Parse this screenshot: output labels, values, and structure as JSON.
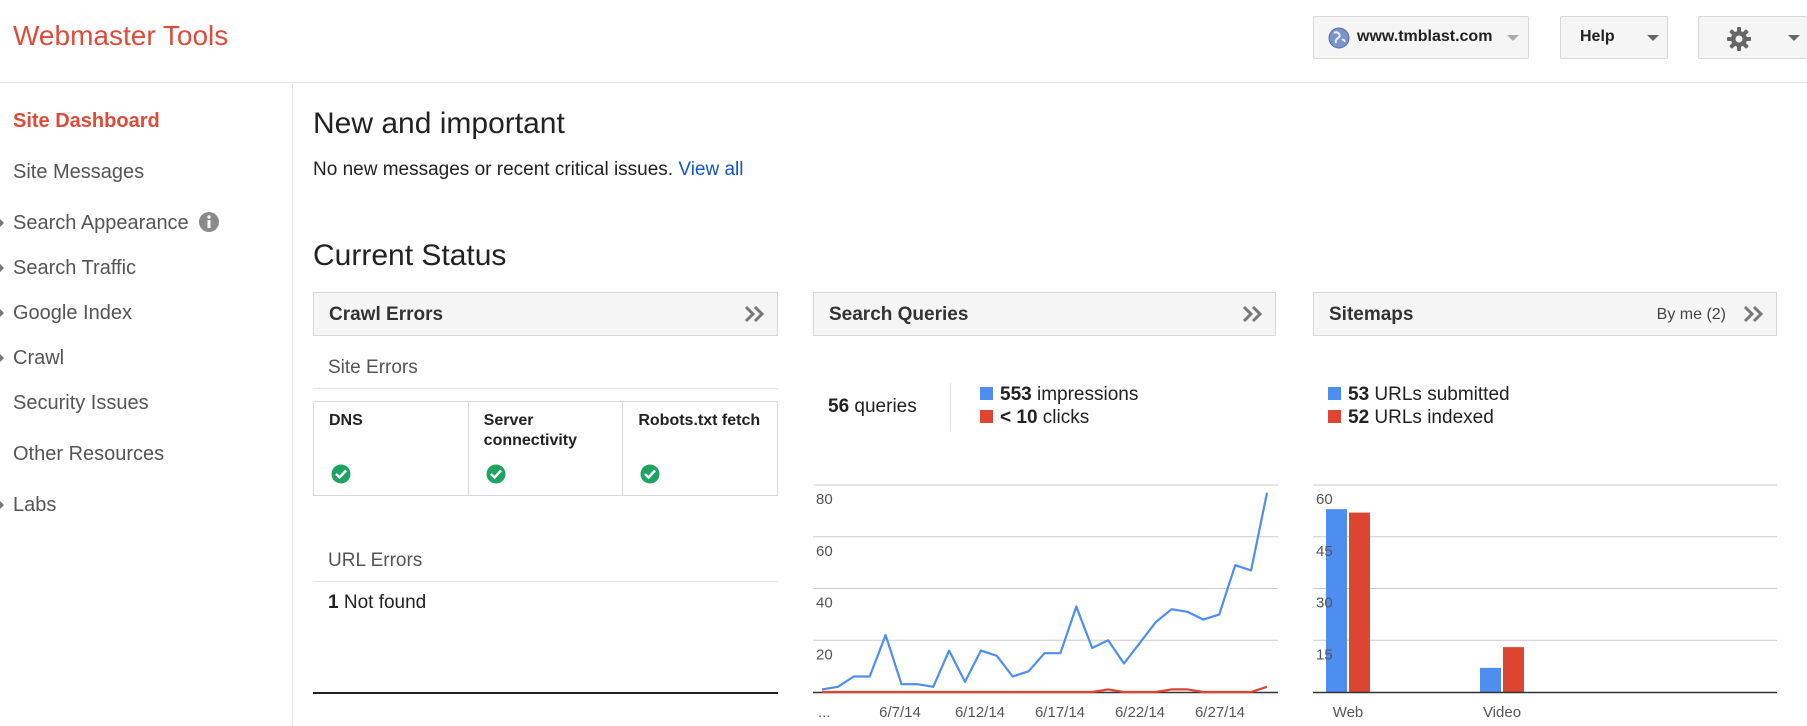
{
  "header": {
    "app_title": "Webmaster Tools",
    "site_selector": "www.tmblast.com",
    "help_label": "Help"
  },
  "sidebar": {
    "items": [
      {
        "label": "Site Dashboard",
        "active": true,
        "expandable": false
      },
      {
        "label": "Site Messages",
        "active": false,
        "expandable": false
      },
      {
        "label": "Search Appearance",
        "active": false,
        "expandable": true
      },
      {
        "label": "Search Traffic",
        "active": false,
        "expandable": true
      },
      {
        "label": "Google Index",
        "active": false,
        "expandable": true
      },
      {
        "label": "Crawl",
        "active": false,
        "expandable": true
      },
      {
        "label": "Security Issues",
        "active": false,
        "expandable": false
      },
      {
        "label": "Other Resources",
        "active": false,
        "expandable": false
      },
      {
        "label": "Labs",
        "active": false,
        "expandable": true
      }
    ]
  },
  "new_important": {
    "heading": "New and important",
    "message": "No new messages or recent critical issues.",
    "link": "View all"
  },
  "current_status": {
    "heading": "Current Status"
  },
  "crawl_errors": {
    "title": "Crawl Errors",
    "site_errors_heading": "Site Errors",
    "site_errors": [
      {
        "label": "DNS",
        "status": "ok"
      },
      {
        "label": "Server connectivity",
        "status": "ok"
      },
      {
        "label": "Robots.txt fetch",
        "status": "ok"
      }
    ],
    "url_errors_heading": "URL Errors",
    "url_errors_count": "1",
    "url_errors_label": "Not found"
  },
  "search_queries": {
    "title": "Search Queries",
    "queries_count": "56",
    "queries_label": "queries",
    "impressions_count": "553",
    "impressions_label": "impressions",
    "clicks_count": "< 10",
    "clicks_label": "clicks"
  },
  "sitemaps": {
    "title": "Sitemaps",
    "filter": "By me (2)",
    "submitted_count": "53",
    "submitted_label": "URLs submitted",
    "indexed_count": "52",
    "indexed_label": "URLs indexed"
  },
  "colors": {
    "brand_red": "#dd4b39",
    "series_blue": "#4d8ef0",
    "series_red": "#dc4530",
    "link": "#1155cc"
  },
  "chart_data": [
    {
      "type": "line",
      "x_tick_labels": [
        "...",
        "6/7/14",
        "6/12/14",
        "6/17/14",
        "6/22/14",
        "6/27/14"
      ],
      "ylim": [
        0,
        80
      ],
      "y_ticks": [
        20,
        40,
        60,
        80
      ],
      "grid": true,
      "series": [
        {
          "name": "impressions",
          "color": "#4d8ef0",
          "values": [
            1,
            2,
            6,
            6,
            22,
            3,
            3,
            2,
            16,
            4,
            16,
            14,
            6,
            8,
            15,
            15,
            33,
            17,
            20,
            11,
            19,
            27,
            32,
            31,
            28,
            30,
            49,
            47,
            77
          ]
        },
        {
          "name": "clicks",
          "color": "#dc4530",
          "values": [
            0,
            0,
            0,
            0,
            0,
            0,
            0,
            0,
            0,
            0,
            0,
            0,
            0,
            0,
            0,
            0,
            0,
            0,
            1,
            0,
            0,
            0,
            1,
            1,
            0,
            0,
            0,
            0,
            2
          ]
        }
      ]
    },
    {
      "type": "bar",
      "categories": [
        "Web",
        "Video"
      ],
      "ylim": [
        0,
        60
      ],
      "y_ticks": [
        15,
        30,
        45,
        60
      ],
      "grid": true,
      "series": [
        {
          "name": "URLs submitted",
          "color": "#4d8ef0",
          "values": [
            53,
            7
          ]
        },
        {
          "name": "URLs indexed",
          "color": "#dc4530",
          "values": [
            52,
            13
          ]
        }
      ]
    }
  ]
}
